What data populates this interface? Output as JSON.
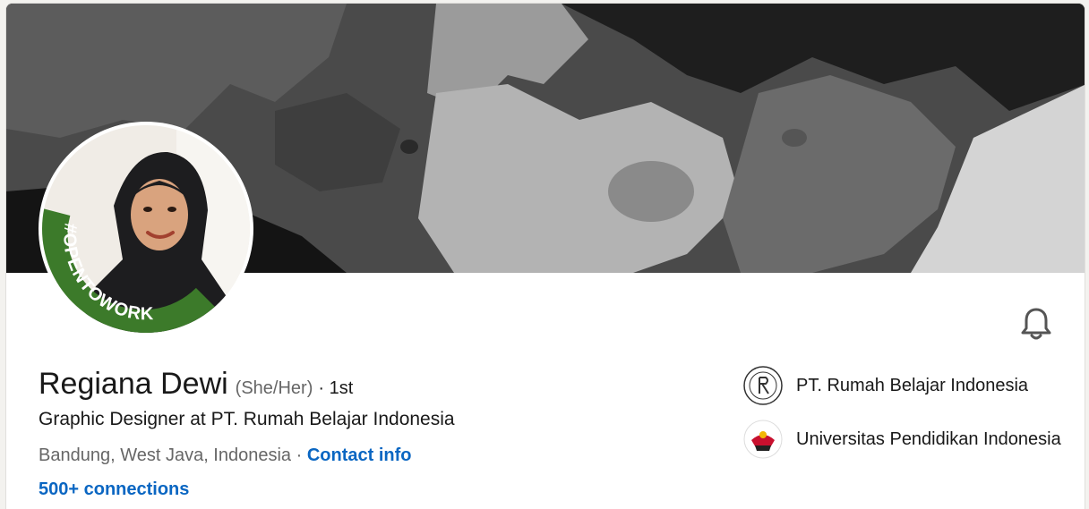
{
  "profile": {
    "name": "Regiana Dewi",
    "pronouns": "(She/Her)",
    "degree": "· 1st",
    "headline": "Graphic Designer at PT. Rumah Belajar Indonesia",
    "location": "Bandung, West Java, Indonesia",
    "location_separator": " · ",
    "contact_label": "Contact info",
    "connections": "500+ connections",
    "open_to_work_badge": "#OPENTOWORK"
  },
  "organizations": [
    {
      "name": "PT. Rumah Belajar Indonesia",
      "logo_icon": "rumah-belajar-logo-icon"
    },
    {
      "name": "Universitas Pendidikan Indonesia",
      "logo_icon": "upi-logo-icon"
    }
  ],
  "icons": {
    "bell": "bell-icon"
  },
  "colors": {
    "link": "#0a66c2",
    "open_to_work": "#3c7a2a",
    "text_primary": "#191919",
    "text_secondary": "#666666"
  }
}
